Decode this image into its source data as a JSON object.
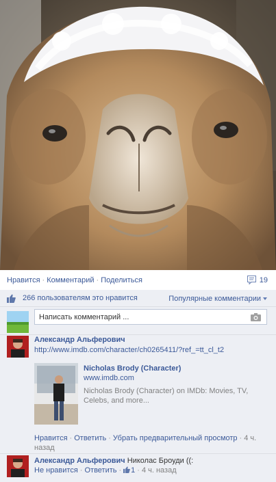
{
  "photo": {
    "subject": "camel-with-snow-on-head"
  },
  "actions": {
    "like": "Нравится",
    "comment": "Комментарий",
    "share": "Поделиться",
    "sep": "·"
  },
  "comment_count": "19",
  "likes": {
    "text": "266 пользователям это нравится",
    "popular_label": "Популярные комментарии"
  },
  "compose": {
    "placeholder": "Написать комментарий ..."
  },
  "comments": [
    {
      "author": "Александр Альферович",
      "url": "http://www.imdb.com/character/ch0265411/?ref_=tt_cl_t2",
      "preview": {
        "title": "Nicholas Brody (Character)",
        "domain": "www.imdb.com",
        "description": "Nicholas Brody (Character) on IMDb: Movies, TV, Celebs, and more..."
      },
      "meta": {
        "like": "Нравится",
        "reply": "Ответить",
        "remove_preview": "Убрать предварительный просмотр",
        "time": "4 ч. назад"
      }
    },
    {
      "author": "Александр Альферович",
      "text": "Николас Броуди ((:",
      "meta": {
        "unlike": "Не нравится",
        "reply": "Ответить",
        "likes": "1",
        "time": "4 ч. назад"
      }
    }
  ],
  "colors": {
    "link": "#3b5998",
    "ufi_bg": "#edeff4",
    "border": "#dcdee3"
  }
}
